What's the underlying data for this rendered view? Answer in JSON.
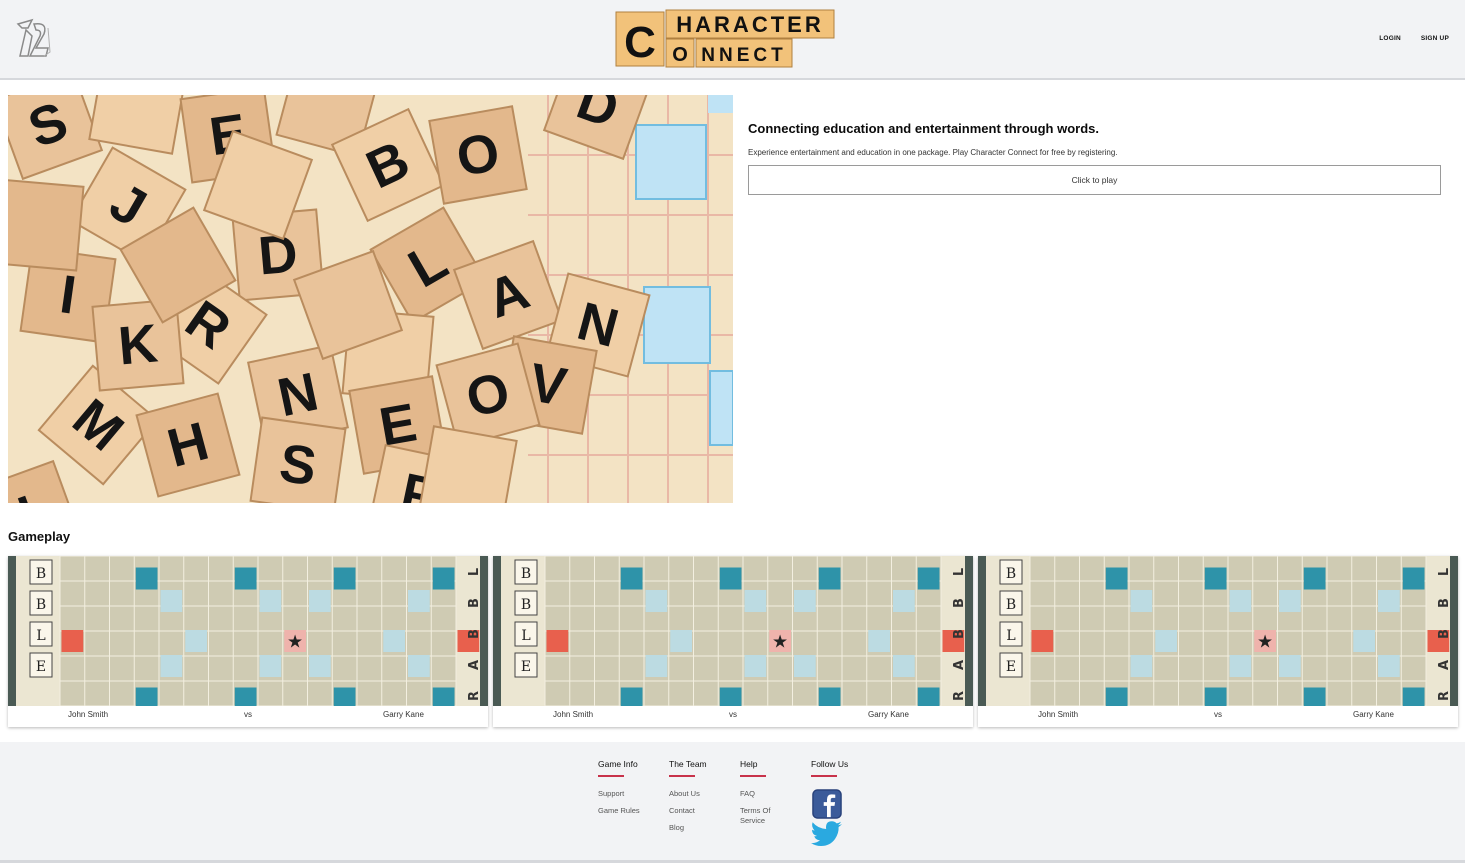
{
  "header": {
    "logo_top_text": "HARACTER",
    "logo_bottom_text": "NNECT",
    "logo_letter_c": "C",
    "logo_letter_o": "O",
    "nav": {
      "login": "LOGIN",
      "signup": "SIGN UP"
    }
  },
  "hero": {
    "title": "Connecting education and entertainment through words.",
    "description": "Experience entertainment and education in one package. Play Character Connect for free by registering.",
    "play_button": "Click to play"
  },
  "gameplay": {
    "title": "Gameplay",
    "matches": [
      {
        "player1": "John Smith",
        "vs": "vs",
        "player2": "Garry Kane"
      },
      {
        "player1": "John Smith",
        "vs": "vs",
        "player2": "Garry Kane"
      },
      {
        "player1": "John Smith",
        "vs": "vs",
        "player2": "Garry Kane"
      }
    ]
  },
  "footer": {
    "game_info": {
      "title": "Game Info",
      "links": [
        "Support",
        "Game Rules"
      ]
    },
    "team": {
      "title": "The Team",
      "links": [
        "About Us",
        "Contact",
        "Blog"
      ]
    },
    "help": {
      "title": "Help",
      "links": [
        "FAQ",
        "Terms Of",
        "Service"
      ]
    },
    "follow": {
      "title": "Follow Us",
      "icons": [
        "facebook-icon",
        "twitter-icon"
      ]
    }
  },
  "colors": {
    "accent": "#c8324a",
    "header_bg": "#f2f3f5",
    "tile": "#f2c27a",
    "board": "#cfcbb3"
  }
}
